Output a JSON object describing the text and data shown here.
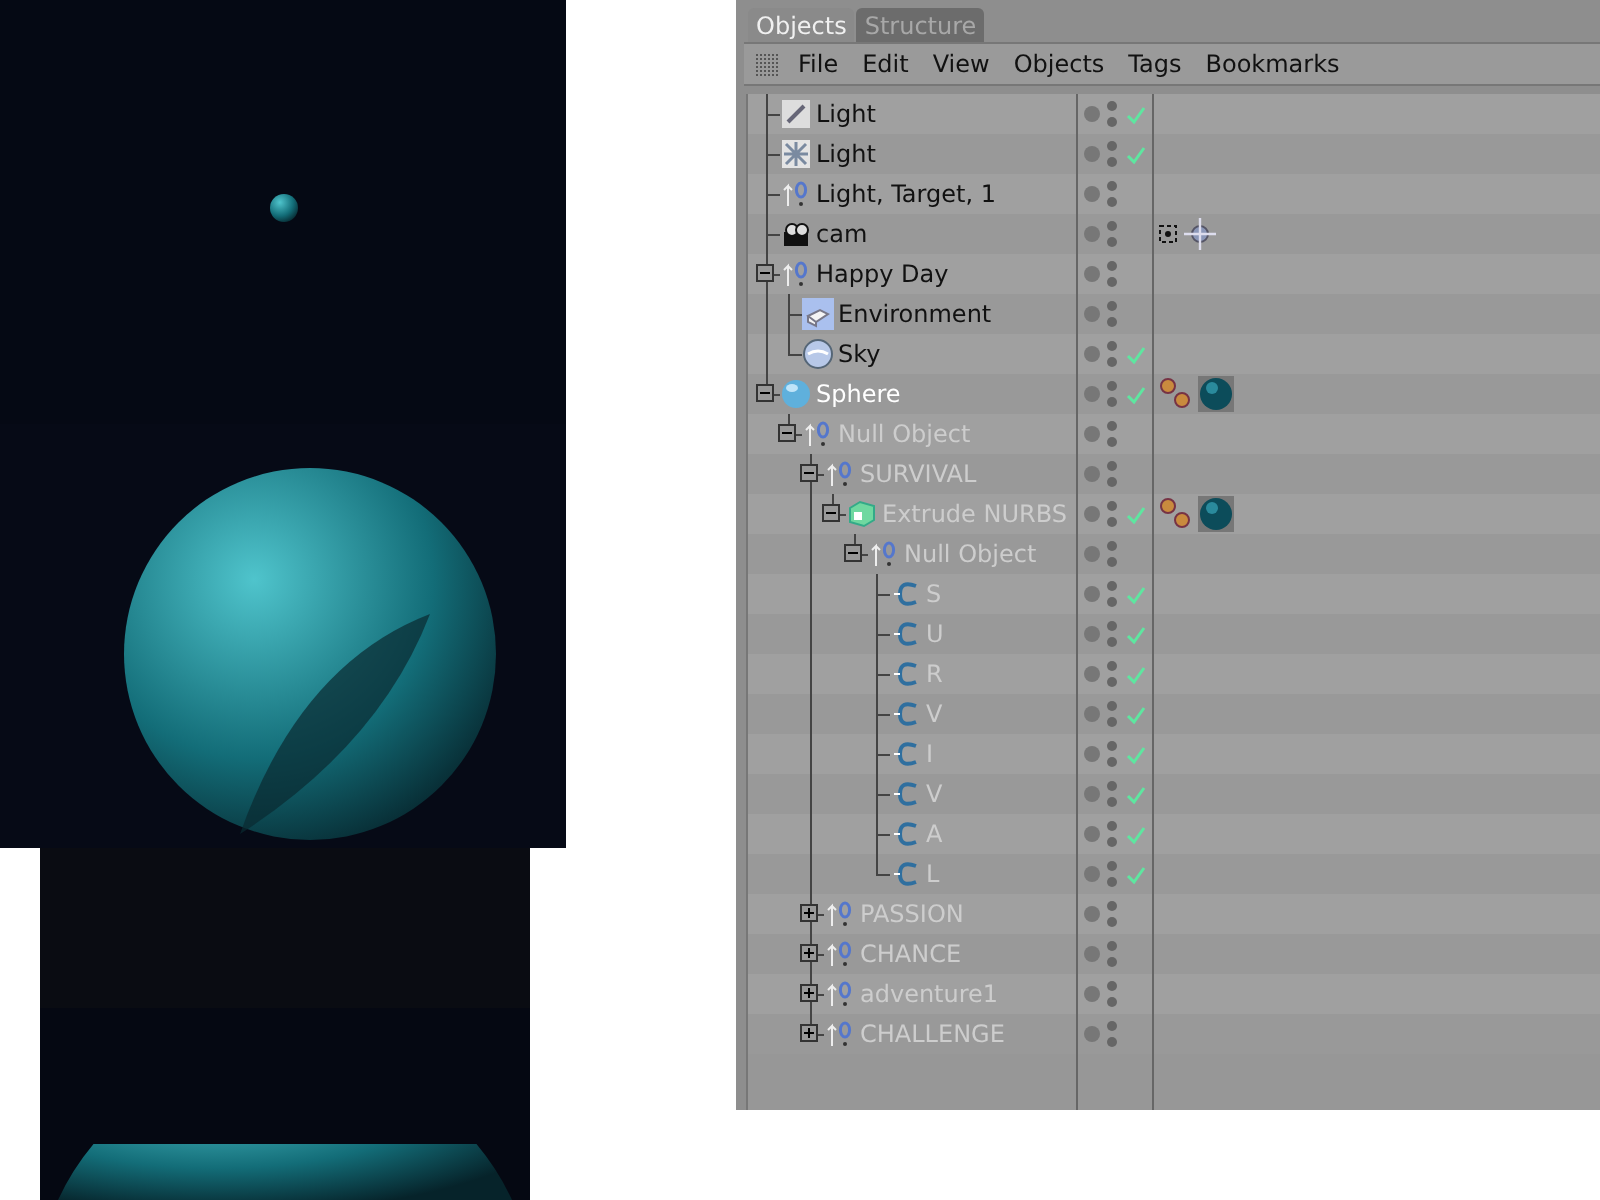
{
  "tabs": [
    {
      "label": "Objects",
      "selected": true
    },
    {
      "label": "Structure",
      "selected": false
    }
  ],
  "menu": [
    "File",
    "Edit",
    "View",
    "Objects",
    "Tags",
    "Bookmarks"
  ],
  "objects": [
    {
      "name": "Light",
      "kind": "spot_light",
      "selected": false,
      "dimmed": false,
      "checked": true
    },
    {
      "name": "Light",
      "kind": "area_light",
      "selected": false,
      "dimmed": false,
      "checked": true
    },
    {
      "name": "Light, Target, 1",
      "kind": "null",
      "selected": false,
      "dimmed": false,
      "checked": false
    },
    {
      "name": "cam",
      "kind": "camera",
      "selected": false,
      "dimmed": false,
      "checked": false,
      "tags": [
        {
          "kind": "protection"
        },
        {
          "kind": "target"
        }
      ]
    },
    {
      "name": "Happy Day",
      "kind": "null",
      "selected": false,
      "dimmed": false,
      "checked": false,
      "expanded": true,
      "children": [
        {
          "name": "Environment",
          "kind": "environment",
          "selected": false,
          "dimmed": false,
          "checked": false
        },
        {
          "name": "Sky",
          "kind": "sky",
          "selected": false,
          "dimmed": false,
          "checked": true
        }
      ]
    },
    {
      "name": "Sphere",
      "kind": "sphere",
      "selected": true,
      "dimmed": false,
      "checked": true,
      "expanded": true,
      "tags": [
        {
          "kind": "texture"
        },
        {
          "kind": "material"
        }
      ],
      "children": [
        {
          "name": "Null Object",
          "kind": "null",
          "selected": false,
          "dimmed": true,
          "checked": false,
          "expanded": true,
          "children": [
            {
              "name": "SURVIVAL",
              "kind": "null",
              "selected": false,
              "dimmed": true,
              "checked": false,
              "expanded": true,
              "children": [
                {
                  "name": "Extrude NURBS",
                  "kind": "extrude",
                  "selected": false,
                  "dimmed": true,
                  "checked": true,
                  "expanded": true,
                  "tags": [
                    {
                      "kind": "texture"
                    },
                    {
                      "kind": "material"
                    }
                  ],
                  "children": [
                    {
                      "name": "Null Object",
                      "kind": "null",
                      "selected": false,
                      "dimmed": true,
                      "checked": false,
                      "expanded": true,
                      "children": [
                        {
                          "name": "S",
                          "kind": "spline",
                          "selected": false,
                          "dimmed": true,
                          "checked": true
                        },
                        {
                          "name": "U",
                          "kind": "spline",
                          "selected": false,
                          "dimmed": true,
                          "checked": true
                        },
                        {
                          "name": "R",
                          "kind": "spline",
                          "selected": false,
                          "dimmed": true,
                          "checked": true
                        },
                        {
                          "name": "V",
                          "kind": "spline",
                          "selected": false,
                          "dimmed": true,
                          "checked": true
                        },
                        {
                          "name": "I",
                          "kind": "spline",
                          "selected": false,
                          "dimmed": true,
                          "checked": true
                        },
                        {
                          "name": "V",
                          "kind": "spline",
                          "selected": false,
                          "dimmed": true,
                          "checked": true
                        },
                        {
                          "name": "A",
                          "kind": "spline",
                          "selected": false,
                          "dimmed": true,
                          "checked": true
                        },
                        {
                          "name": "L",
                          "kind": "spline",
                          "selected": false,
                          "dimmed": true,
                          "checked": true
                        }
                      ]
                    }
                  ]
                }
              ]
            },
            {
              "name": "PASSION",
              "kind": "null",
              "selected": false,
              "dimmed": true,
              "checked": false,
              "expanded": false
            },
            {
              "name": "CHANCE",
              "kind": "null",
              "selected": false,
              "dimmed": true,
              "checked": false,
              "expanded": false
            },
            {
              "name": "adventure1",
              "kind": "null",
              "selected": false,
              "dimmed": true,
              "checked": false,
              "expanded": false
            },
            {
              "name": "CHALLENGE",
              "kind": "null",
              "selected": false,
              "dimmed": true,
              "checked": false,
              "expanded": false
            }
          ]
        }
      ]
    }
  ]
}
